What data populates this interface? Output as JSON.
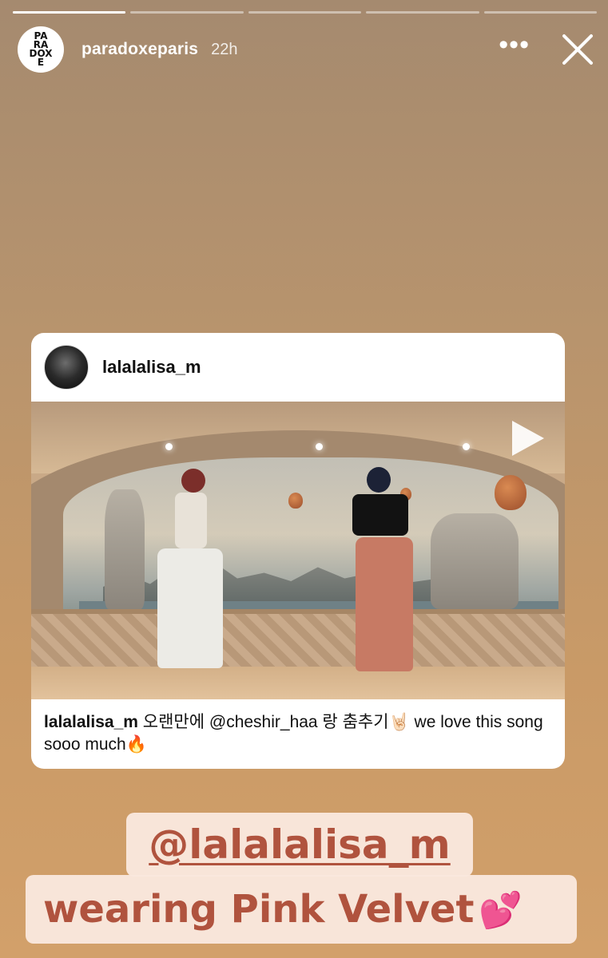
{
  "story": {
    "segments": [
      {
        "progress": 1.0
      },
      {
        "progress": 0
      },
      {
        "progress": 0
      },
      {
        "progress": 0
      },
      {
        "progress": 0
      }
    ],
    "username": "paradoxeparis",
    "time": "22h",
    "logo_text": "PA\nRA\nDOX\nE",
    "more_icon": "more-dots-icon",
    "close_icon": "close-icon"
  },
  "post": {
    "username": "lalalalisa_m",
    "caption_user": "lalalalisa_m",
    "caption_text": " 오랜만에 @cheshir_haa 랑 춤추기🤘🏻  we love this song sooo much🔥",
    "play_icon": "play-icon"
  },
  "stickers": {
    "mention": "@lalalalisa_m",
    "line2": "wearing  Pink Velvet",
    "emoji": "💕"
  },
  "colors": {
    "sticker_text": "#b0533e",
    "sticker_bg": "#fae8de",
    "background_top": "#a58a6f",
    "background_bottom": "#d2a06a"
  }
}
